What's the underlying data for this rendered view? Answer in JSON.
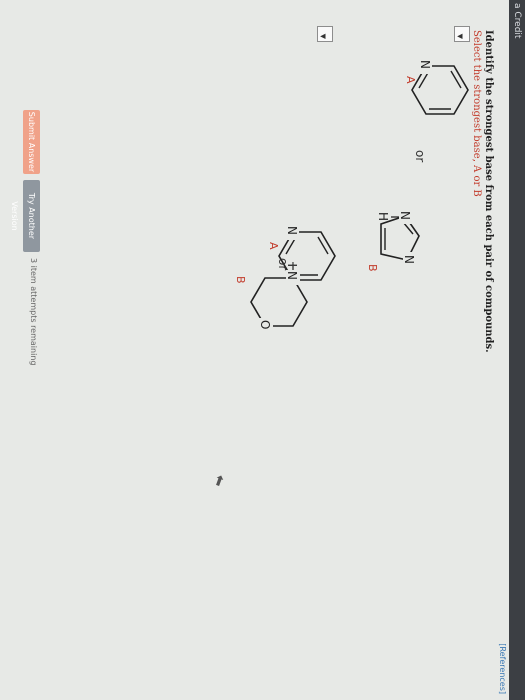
{
  "window": {
    "credit_label": "a Credit"
  },
  "references_link": "[References]",
  "question": {
    "title": "Identify the strongest base from each pair of compounds.",
    "instruction": "Select the strongest base, A or B"
  },
  "pairs": [
    {
      "selected": "",
      "or_label": "or",
      "a": {
        "tag": "A",
        "compound": "pyridine",
        "atom": "N"
      },
      "b": {
        "tag": "B",
        "compound": "imidazole",
        "atoms": [
          "N",
          "N",
          "H"
        ]
      }
    },
    {
      "selected": "",
      "or_label": "or",
      "a": {
        "tag": "A",
        "compound": "pyridine",
        "atom": "N"
      },
      "b": {
        "tag": "B",
        "compound": "morpholine",
        "atoms": [
          "O",
          "N",
          "H"
        ]
      }
    }
  ],
  "buttons": {
    "submit": "Submit Answer",
    "try_another": "Try Another Version"
  },
  "attempts_text": "3 item attempts remaining",
  "colors": {
    "accent_red": "#c23a2a",
    "submit_bg": "#f0a289",
    "secondary_bg": "#8f979f",
    "link": "#3a78b5"
  },
  "icons": {
    "dropdown": "chevron-down-icon",
    "cursor": "mouse-pointer-icon"
  }
}
